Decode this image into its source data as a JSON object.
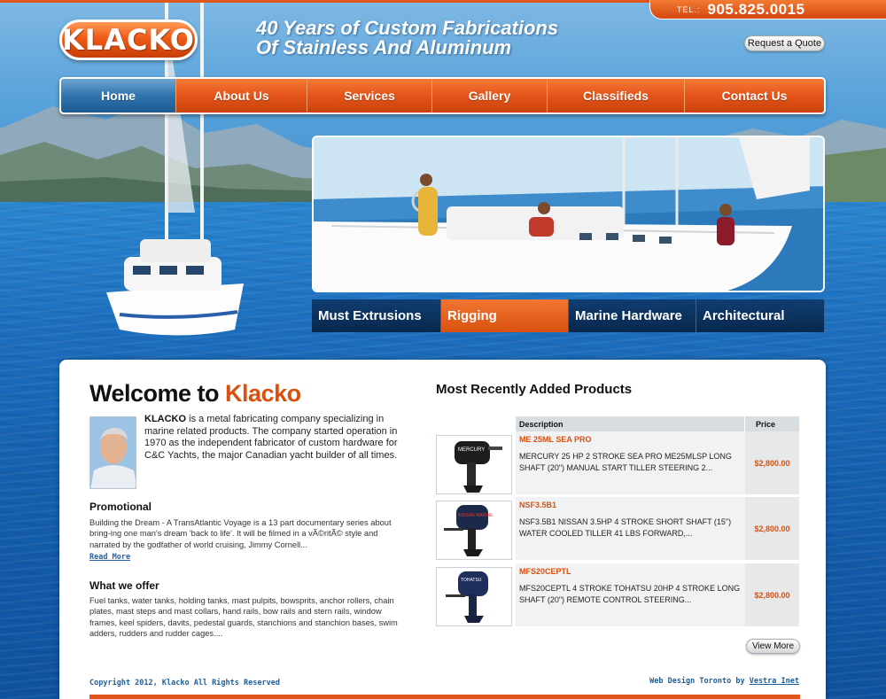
{
  "header": {
    "phone_prefix": "TEL.:",
    "phone_number": "905.825.0015",
    "logo_text": "KLACKO",
    "tagline_line1": "40 Years of Custom Fabrications",
    "tagline_line2": "Of Stainless And Aluminum",
    "quote_button": "Request a Quote"
  },
  "nav": {
    "items": [
      {
        "label": "Home"
      },
      {
        "label": "About Us"
      },
      {
        "label": "Services"
      },
      {
        "label": "Gallery"
      },
      {
        "label": "Classifieds"
      },
      {
        "label": "Contact Us"
      }
    ]
  },
  "categories": [
    {
      "label": "Must Extrusions"
    },
    {
      "label": "Rigging"
    },
    {
      "label": "Marine Hardware"
    },
    {
      "label": "Architectural"
    }
  ],
  "welcome": {
    "title_prefix": "Welcome to ",
    "title_accent": "Klacko",
    "intro_bold": "KLACKO",
    "intro_text": " is a metal fabricating company specializing in marine related products. The company started operation in 1970 as the independent fabricator of custom hardware for C&C Yachts, the major Canadian yacht builder of all times."
  },
  "promotional": {
    "title": "Promotional",
    "body": "Building the Dream - A TransAtlantic Voyage is a 13 part documentary series about bring-ing one man's dream 'back to life'. It will be filmed in a vÃ©ritÃ© style and narrated by the godfather of world cruising, Jimmy Cornell...",
    "read_more": "Read More"
  },
  "offer": {
    "title": "What we offer",
    "body": "Fuel tanks, water tanks, holding tanks, mast pulpits, bowsprits, anchor rollers, chain plates, mast steps and mast collars, hand rails, bow rails and stern rails, window frames, keel spiders, davits, pedestal guards, stanchions and stanchion bases, swim adders, rudders and rudder cages...."
  },
  "products": {
    "title": "Most Recently Added Products",
    "col_description": "Description",
    "col_price": "Price",
    "rows": [
      {
        "code": "ME 25ML SEA PRO",
        "description": "MERCURY 25 HP 2 STROKE SEA PRO ME25MLSP LONG SHAFT (20\") MANUAL START TILLER STEERING 2...",
        "price": "$2,800.00",
        "thumb_brand": "MERCURY"
      },
      {
        "code": "NSF3.5B1",
        "description": "NSF3.5B1 NISSAN 3.5HP 4 STROKE SHORT SHAFT (15\") WATER COOLED TILLER 41 LBS FORWARD,...",
        "price": "$2,800.00",
        "thumb_brand": "NISSAN MARINE"
      },
      {
        "code": "MFS20CEPTL",
        "description": "MFS20CEPTL 4 STROKE TOHATSU 20HP 4 STROKE LONG SHAFT (20\") REMOTE CONTROL STEERING...",
        "price": "$2,800.00",
        "thumb_brand": "TOHATSU"
      }
    ],
    "view_more": "View More"
  },
  "footer": {
    "copyright": "Copyright 2012, Klacko All Rights Reserved",
    "credit_prefix": "Web Design Toronto by ",
    "credit_link": "Vestra Inet"
  },
  "colors": {
    "accent_orange": "#e0561a",
    "nav_blue": "#2f73ad",
    "link_blue": "#1f5e99"
  }
}
